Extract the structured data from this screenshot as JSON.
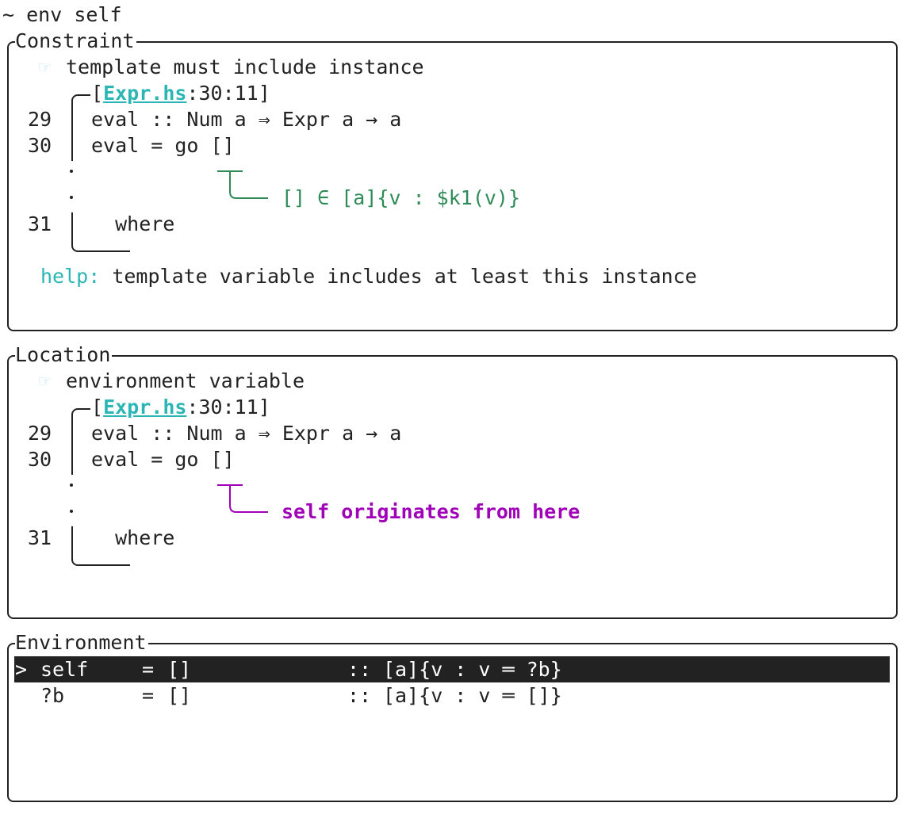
{
  "prompt": {
    "symbol": "~",
    "command": "env self"
  },
  "constraint": {
    "title": "Constraint",
    "bullet_icon": "pointing-hand-icon",
    "message": "template must include instance",
    "location": {
      "file": "Expr.hs",
      "pos": ":30:11",
      "open": "[",
      "close": "]"
    },
    "lines": [
      {
        "num": "29",
        "code": "eval :: Num a ⇒ Expr a → a"
      },
      {
        "num": "30",
        "code": "eval = go []"
      },
      {
        "num": "31",
        "code": "  where"
      }
    ],
    "annotation": "[] ∈ [a]{v : $k1(v)}",
    "annotation_color": "#2e8b57",
    "help_label": "help:",
    "help_text": "template variable includes at least this instance"
  },
  "location_panel": {
    "title": "Location",
    "bullet_icon": "pointing-hand-icon",
    "message": "environment variable",
    "location": {
      "file": "Expr.hs",
      "pos": ":30:11",
      "open": "[",
      "close": "]"
    },
    "lines": [
      {
        "num": "29",
        "code": "eval :: Num a ⇒ Expr a → a"
      },
      {
        "num": "30",
        "code": "eval = go []"
      },
      {
        "num": "31",
        "code": "  where"
      }
    ],
    "annotation": "self originates from here",
    "annotation_color": "#a000b8"
  },
  "environment": {
    "title": "Environment",
    "rows": [
      {
        "marker": ">",
        "name": "self",
        "eq": "=",
        "value": "[]",
        "sep": "::",
        "type": "[a]{v : v ═ ?b}",
        "selected": true
      },
      {
        "marker": "",
        "name": "?b",
        "eq": "=",
        "value": "[]",
        "sep": "::",
        "type": "[a]{v : v ═ []}",
        "selected": false
      }
    ]
  },
  "colors": {
    "link": "#2bb5b5",
    "help": "#2bb5b5",
    "selection_bg": "#222222"
  }
}
